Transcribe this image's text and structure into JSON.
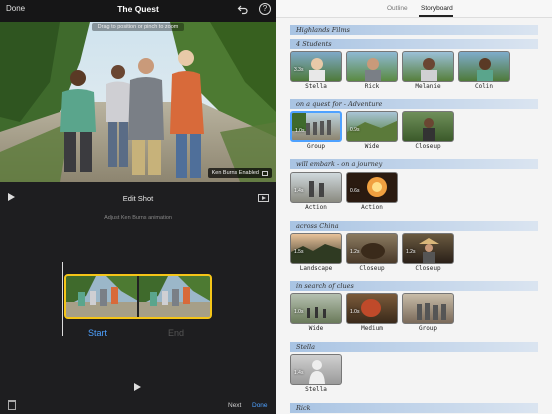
{
  "editor": {
    "done_label": "Done",
    "title": "The Quest",
    "drag_hint": "Drag to position or pinch to zoom",
    "ken_burns_badge": "Ken Burns Enabled",
    "edit_shot_label": "Edit Shot",
    "adjust_label": "Adjust Ken Burns animation",
    "start_label": "Start",
    "end_label": "End",
    "next_label": "Next",
    "done_button_label": "Done"
  },
  "storyboard": {
    "tabs": [
      "Outline",
      "Storyboard"
    ],
    "selected_tab": "Storyboard",
    "sections": [
      {
        "title": "Highlands Films"
      },
      {
        "title": "4 Students",
        "shots": [
          {
            "label": "Stella",
            "duration": "3.3s"
          },
          {
            "label": "Rick",
            "duration": ""
          },
          {
            "label": "Melanie",
            "duration": ""
          },
          {
            "label": "Colin",
            "duration": ""
          }
        ]
      },
      {
        "title": "on a quest for - Adventure",
        "shots": [
          {
            "label": "Group",
            "duration": "1.0s"
          },
          {
            "label": "Wide",
            "duration": "0.9s"
          },
          {
            "label": "Closeup",
            "duration": ""
          }
        ]
      },
      {
        "title": "will embark - on a journey",
        "shots": [
          {
            "label": "Action",
            "duration": "1.4s"
          },
          {
            "label": "Action",
            "duration": "0.6s"
          }
        ]
      },
      {
        "title": "across China",
        "shots": [
          {
            "label": "Landscape",
            "duration": "1.5s"
          },
          {
            "label": "Closeup",
            "duration": "1.2s"
          },
          {
            "label": "Closeup",
            "duration": "1.2s"
          }
        ]
      },
      {
        "title": "in search of clues",
        "shots": [
          {
            "label": "Wide",
            "duration": "1.0s"
          },
          {
            "label": "Medium",
            "duration": "1.0s"
          },
          {
            "label": "Group",
            "duration": ""
          }
        ]
      },
      {
        "title": "Stella",
        "shots": [
          {
            "label": "Stella",
            "duration": "1.4s"
          }
        ]
      },
      {
        "title": "Rick"
      }
    ]
  }
}
